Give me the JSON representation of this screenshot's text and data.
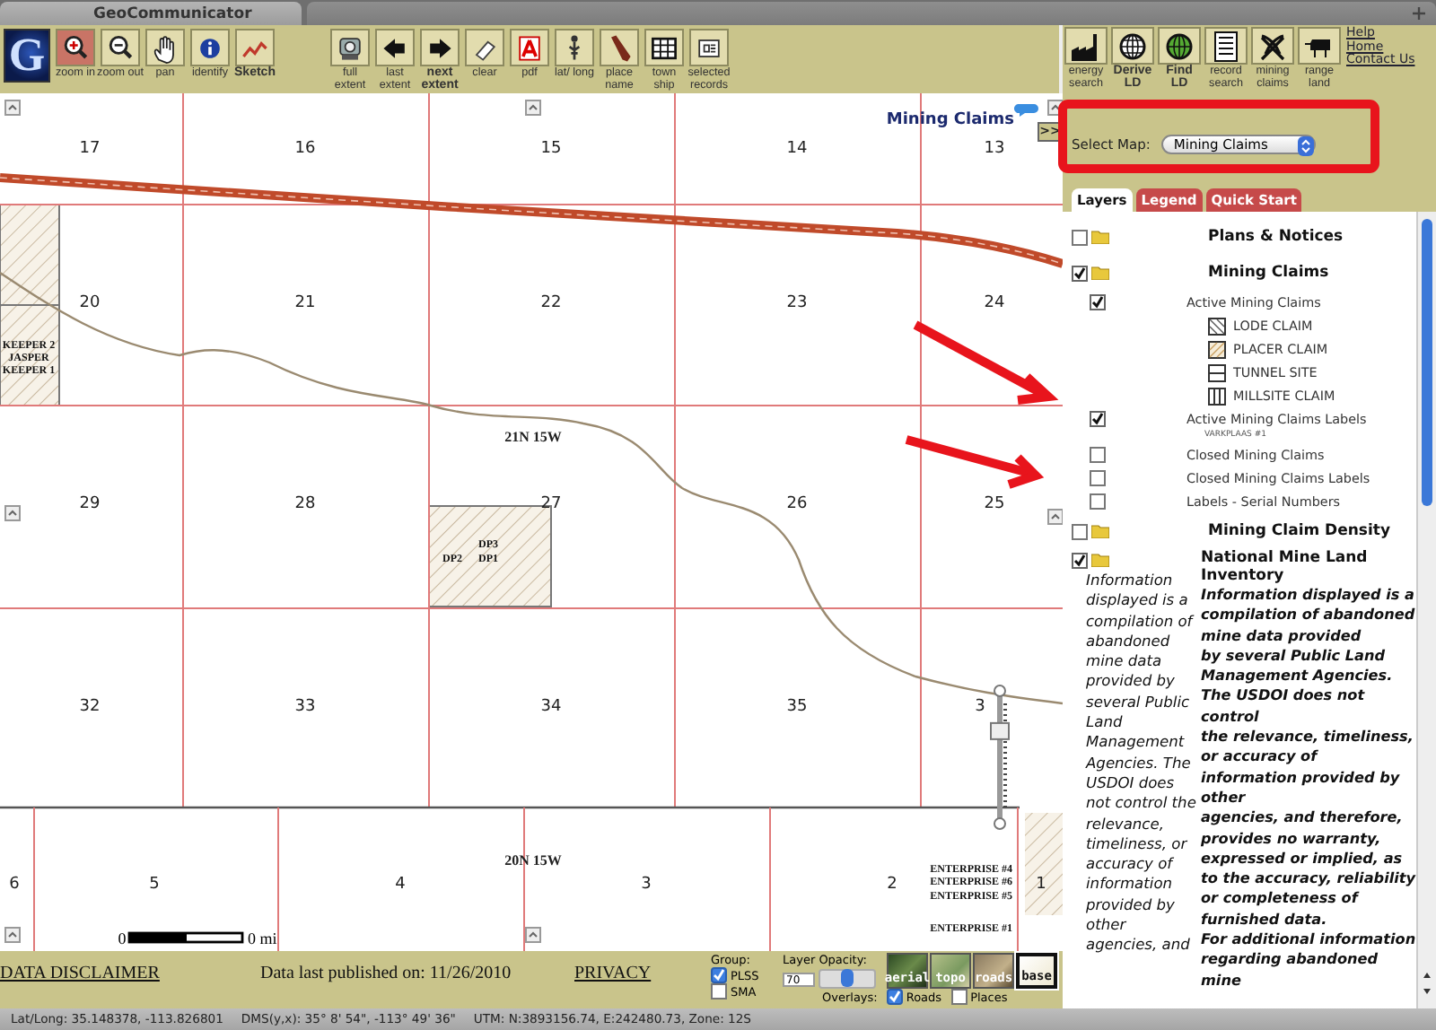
{
  "window": {
    "title": "GeoCommunicator"
  },
  "toolbar": {
    "logo": "G",
    "tools": [
      {
        "label": "zoom in",
        "selected": true
      },
      {
        "label": "zoom out",
        "selected": false
      },
      {
        "label": "pan",
        "selected": false
      },
      {
        "label": "identify",
        "selected": false
      },
      {
        "label": "Sketch",
        "selected": false
      },
      {
        "label": "full extent",
        "selected": false
      },
      {
        "label": "last extent",
        "selected": false
      },
      {
        "label": "next extent",
        "selected": false
      },
      {
        "label": "clear",
        "selected": false
      },
      {
        "label": "pdf",
        "selected": false
      },
      {
        "label": "lat/ long",
        "selected": false
      },
      {
        "label": "place name",
        "selected": false
      },
      {
        "label": "town ship",
        "selected": false
      },
      {
        "label": "selected records",
        "selected": false
      }
    ],
    "app_tools": [
      "energy search",
      "Derive LD",
      "Find LD",
      "record search",
      "mining claims",
      "range land"
    ],
    "links": [
      "Help",
      "Home",
      "Contact Us"
    ]
  },
  "map": {
    "title": "Mining Claims",
    "expand_label": ">>",
    "sections": [
      [
        "17",
        "16",
        "15",
        "14",
        "13"
      ],
      [
        "20",
        "21",
        "22",
        "23",
        "24"
      ],
      [
        "29",
        "28",
        "27",
        "26",
        "25"
      ],
      [
        "32",
        "33",
        "34",
        "35",
        "3"
      ]
    ],
    "bottom_sections": [
      "6",
      "5",
      "4",
      "3",
      "2",
      "1"
    ],
    "townships": [
      "21N 15W",
      "20N 15W"
    ],
    "claims": [
      [
        "KEEPER 2",
        "JASPER",
        "KEEPER 1"
      ],
      [
        "DP3",
        "DP2",
        "DP1"
      ],
      [
        "ENTERPRISE #4",
        "ENTERPRISE #6",
        "ENTERPRISE #5"
      ],
      [
        "ENTERPRISE #1"
      ]
    ],
    "scale": {
      "start": "0",
      "end": "0 mi"
    },
    "zoom_slider": {
      "level": 0.69
    }
  },
  "panel": {
    "select_map": {
      "label": "Select Map:",
      "value": "Mining Claims"
    },
    "tabs": [
      {
        "label": "Layers",
        "selected": true
      },
      {
        "label": "Legend",
        "selected": false
      },
      {
        "label": "Quick Start",
        "selected": false
      }
    ],
    "layers": [
      {
        "label": "Plans & Notices",
        "checked": false
      },
      {
        "label": "Mining Claims",
        "checked": true,
        "children": [
          {
            "label": "Active Mining Claims",
            "checked": true,
            "legend": [
              "LODE CLAIM",
              "PLACER CLAIM",
              "TUNNEL SITE",
              "MILLSITE CLAIM"
            ]
          },
          {
            "label": "Active Mining Claims Labels",
            "checked": true,
            "note": "VARKPLAAS #1"
          },
          {
            "label": "Closed Mining Claims",
            "checked": false
          },
          {
            "label": "Closed Mining Claims Labels",
            "checked": false
          },
          {
            "label": "Labels - Serial Numbers",
            "checked": false
          }
        ]
      },
      {
        "label": "Mining Claim Density",
        "checked": false
      },
      {
        "label": "National Mine Land Inventory",
        "checked": true,
        "description": "Information displayed is a compilation of abandoned mine data provided by several Public Land Management Agencies. The USDOI does not control the relevance, timeliness, or accuracy of information provided by other agencies, and",
        "info": "Information displayed is a compilation of abandoned mine data provided\nby several Public Land Management Agencies. The USDOI does not control\nthe relevance, timeliness, or accuracy of information provided by other\nagencies, and therefore, provides no warranty, expressed or implied, as to the accuracy, reliability or completeness of furnished data.\nFor additional information regarding abandoned mine"
      }
    ]
  },
  "footer": {
    "disclaimer": "DATA DISCLAIMER",
    "published": "Data last published on: 11/26/2010",
    "privacy": "PRIVACY",
    "group": {
      "label": "Group:",
      "options": [
        {
          "label": "PLSS",
          "checked": true
        },
        {
          "label": "SMA",
          "checked": false
        }
      ]
    },
    "opacity": {
      "label": "Layer Opacity:",
      "value": "70",
      "level": 0.5
    },
    "overlays": {
      "label": "Overlays:",
      "options": [
        {
          "label": "Roads",
          "checked": true
        },
        {
          "label": "Places",
          "checked": false
        }
      ]
    },
    "basemaps": [
      {
        "label": "aerial",
        "selected": false
      },
      {
        "label": "topo",
        "selected": false
      },
      {
        "label": "roads",
        "selected": false
      },
      {
        "label": "base",
        "selected": true
      }
    ]
  },
  "status_bar": [
    "Lat/Long: 35.148378, -113.826801",
    "DMS(y,x): 35° 8' 54\", -113° 49' 36\"",
    "UTM: N:3893156.74, E:242480.73, Zone: 12S"
  ]
}
